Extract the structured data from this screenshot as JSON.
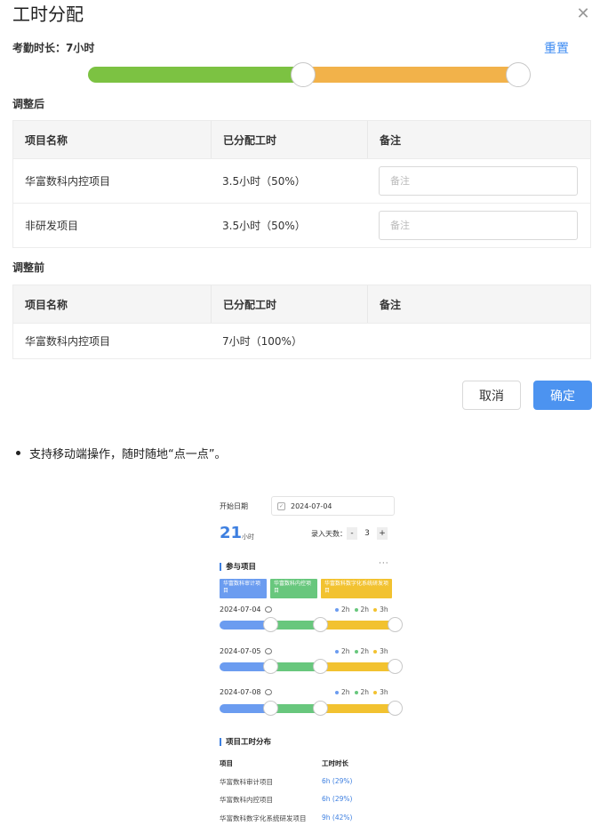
{
  "dialog": {
    "title": "工时分配",
    "close_icon": "close-icon",
    "attendance_label": "考勤时长：7小时",
    "reset_label": "重置",
    "slider": {
      "fractions": [
        0.5,
        0.5
      ],
      "colors": [
        "#7cc242",
        "#f2b24a"
      ]
    },
    "after": {
      "label": "调整后",
      "headers": [
        "项目名称",
        "已分配工时",
        "备注"
      ],
      "rows": [
        {
          "project": "华富数科内控项目",
          "hours": "3.5小时（50%）",
          "note_placeholder": "备注"
        },
        {
          "project": "非研发项目",
          "hours": "3.5小时（50%）",
          "note_placeholder": "备注"
        }
      ]
    },
    "before": {
      "label": "调整前",
      "headers": [
        "项目名称",
        "已分配工时",
        "备注"
      ],
      "rows": [
        {
          "project": "华富数科内控项目",
          "hours": "7小时（100%）",
          "note": ""
        }
      ]
    },
    "cancel_label": "取消",
    "confirm_label": "确定",
    "accent_color": "#4c93f0"
  },
  "bullet": {
    "text": "支持移动端操作，随时随地“点一点”。"
  },
  "mobile": {
    "start_date_label": "开始日期",
    "start_date_value": "2024-07-04",
    "total_hours": "21",
    "total_unit": "小时",
    "days_label": "录入天数：",
    "days_minus": "-",
    "days_value": "3",
    "days_plus": "+",
    "projects_section": "参与项目",
    "more_icon": "ellipsis-icon",
    "more_text": "···",
    "tags": [
      "华富数科审计项目",
      "华富数科内控项目",
      "华富数科数字化系统研发项目"
    ],
    "days": [
      {
        "date": "2024-07-04",
        "legend": [
          "2h",
          "2h",
          "3h"
        ]
      },
      {
        "date": "2024-07-05",
        "legend": [
          "2h",
          "2h",
          "3h"
        ]
      },
      {
        "date": "2024-07-08",
        "legend": [
          "2h",
          "2h",
          "3h"
        ]
      }
    ],
    "colors": [
      "#6b9cf0",
      "#68c77d",
      "#f2c230"
    ],
    "distribution_section": "项目工时分布",
    "dist_headers": [
      "项目",
      "工时时长"
    ],
    "dist_rows": [
      {
        "project": "华富数科审计项目",
        "hours": "6h (29%)"
      },
      {
        "project": "华富数科内控项目",
        "hours": "6h (29%)"
      },
      {
        "project": "华富数科数字化系统研发项目",
        "hours": "9h (42%)"
      }
    ]
  }
}
